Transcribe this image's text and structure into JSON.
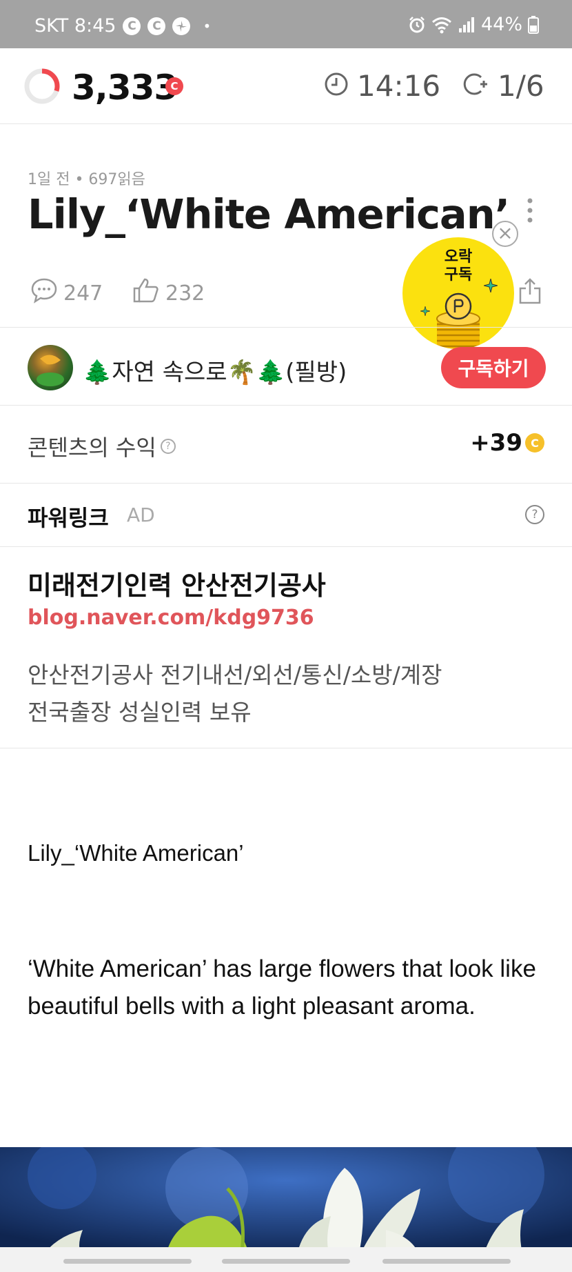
{
  "status_bar": {
    "carrier_time": "SKT 8:45",
    "notif_1": "C",
    "notif_2": "C",
    "dot": "•",
    "battery": "44%"
  },
  "app_bar": {
    "coins": "3,333",
    "coin_badge": "C",
    "timer": "14:16",
    "page_counter": "1/6",
    "progress_fraction": 0.3
  },
  "article": {
    "meta": "1일 전 • 697읽음",
    "title": "Lily_‘White American’",
    "comments": "247",
    "likes": "232"
  },
  "subscribe_badge": {
    "label_line1": "오락",
    "label_line2": "구독"
  },
  "author": {
    "name": "🌲자연 속으로🌴🌲(필방)",
    "subscribe_label": "구독하기"
  },
  "revenue": {
    "label": "콘텐츠의 수익",
    "help": "?",
    "value": "+39",
    "coin": "C"
  },
  "powerlink": {
    "title": "파워링크",
    "ad_tag": "AD",
    "help": "?",
    "ad_title": "미래전기인력 안산전기공사",
    "ad_url": "blog.naver.com/kdg9736",
    "ad_desc_line1": "안산전기공사 전기내선/외선/통신/소방/계장",
    "ad_desc_line2": "전국출장 성실인력 보유"
  },
  "body": {
    "heading": "Lily_‘White American’",
    "paragraph": "‘White American’ has large flowers that look like beautiful bells with a light pleasant aroma."
  },
  "colors": {
    "accent_red": "#f0494f",
    "badge_yellow": "#fbe10f",
    "url_red": "#e0555a",
    "statusbar_gray": "#a3a3a3"
  }
}
